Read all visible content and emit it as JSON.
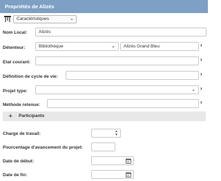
{
  "window": {
    "title": "Propriétés de Alizés"
  },
  "toolbar": {
    "dropdown_label": "Caractéristiques"
  },
  "form": {
    "nom_local": {
      "label": "Nom Local:",
      "value": "Alizés"
    },
    "detenteur": {
      "label": "Détenteur:",
      "type_value": "Bibliothèque",
      "entity_value": "Alizés Grand Bleu"
    },
    "etat_courant": {
      "label": "Etat courant:",
      "value": ""
    },
    "definition_cycle": {
      "label": "Définition de cycle de vie:",
      "value": ""
    },
    "projet_type": {
      "label": "Projet type:",
      "value": ""
    },
    "methode_retenue": {
      "label": "Méthode retenue:",
      "value": ""
    }
  },
  "participants": {
    "label": "Participants"
  },
  "details": {
    "charge": {
      "label": "Charge de travail:",
      "value": ""
    },
    "pourcentage": {
      "label": "Pourcentage d'avancement du projet:",
      "value": ""
    },
    "date_debut": {
      "label": "Date de début:",
      "value": ""
    },
    "date_fin": {
      "label": "Date de fin:",
      "value": ""
    }
  },
  "icons": {
    "toolbar": "hierarchy-icon",
    "chevron_down": "chevron-down-icon",
    "chevron_right": "chevron-right-icon",
    "expand": "plus-icon",
    "spinner": "spinner-icon",
    "calendar": "calendar-icon"
  },
  "colors": {
    "titlebar": "#7da0c4",
    "section": "#e8e8e8"
  }
}
